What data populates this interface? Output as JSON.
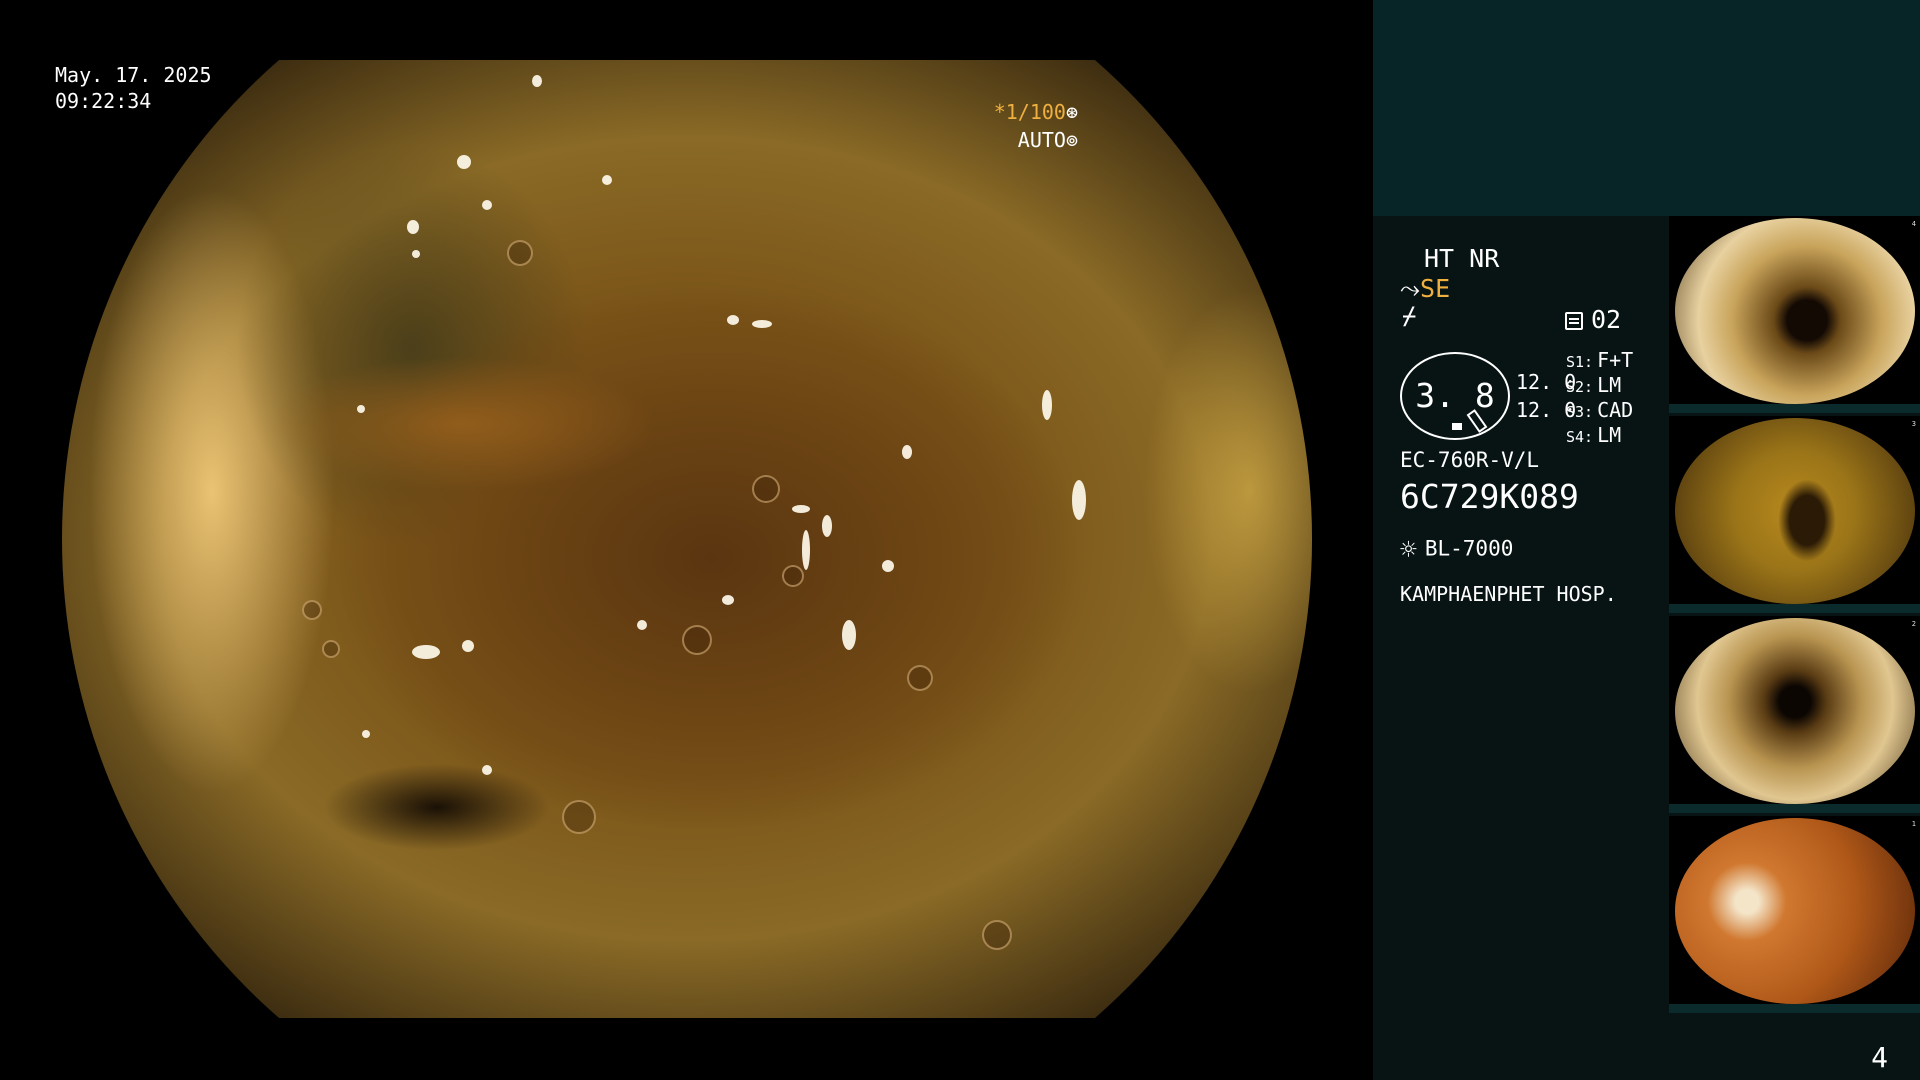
{
  "overlay": {
    "date": "May. 17. 2025",
    "time": "09:22:34",
    "shutter": "*1/100",
    "shutter_icon": "aperture-icon",
    "iris_mode": "AUTO",
    "iris_icon": "iris-icon"
  },
  "panel": {
    "ht_nr": "HT NR",
    "se_label": "SE",
    "memory": "02",
    "gauge_value": "3. 8",
    "level_1": "12. 0",
    "level_2": "12. 0",
    "switches": [
      {
        "key": "S1:",
        "value": "F+T"
      },
      {
        "key": "S2:",
        "value": "LM"
      },
      {
        "key": "S3:",
        "value": "CAD"
      },
      {
        "key": "S4:",
        "value": "LM"
      }
    ],
    "scope_model": "EC-760R-V/L",
    "scope_serial": "6C729K089",
    "light_source": "BL-7000",
    "hospital": "KAMPHAENPHET HOSP."
  },
  "thumbnails": [
    {
      "index": "4"
    },
    {
      "index": "3"
    },
    {
      "index": "2"
    },
    {
      "index": "1"
    }
  ],
  "page_number": "4"
}
